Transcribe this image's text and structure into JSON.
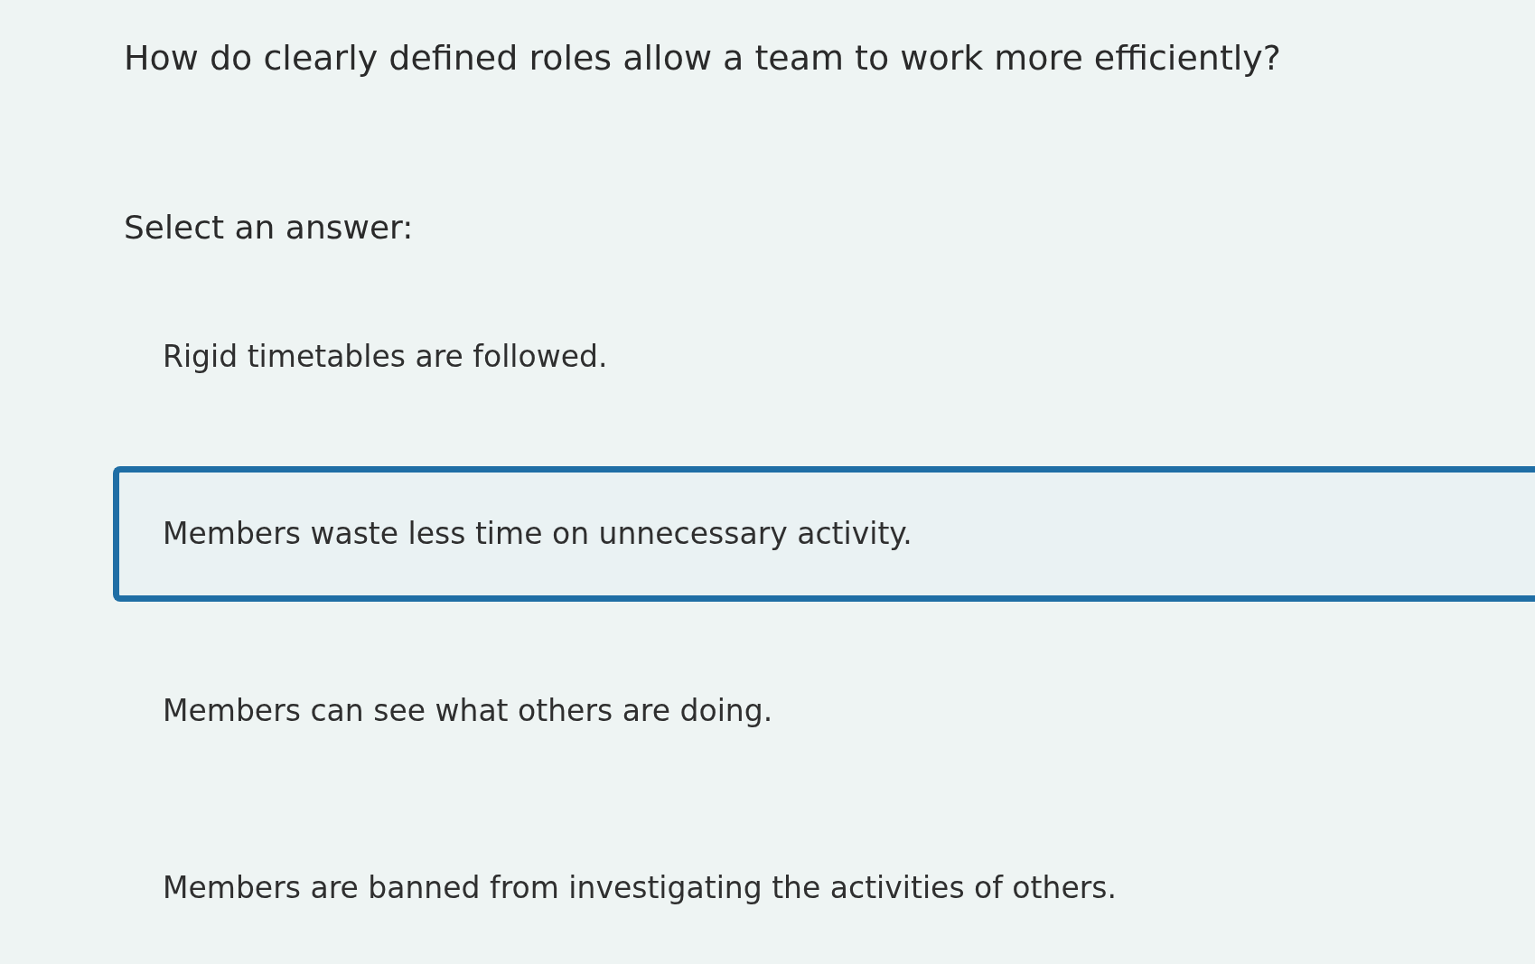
{
  "question": "How do clearly defined roles allow a team to work more efficiently?",
  "prompt": "Select an answer:",
  "options": [
    {
      "text": "Rigid timetables are followed.",
      "selected": false
    },
    {
      "text": "Members waste less time on unnecessary activity.",
      "selected": true
    },
    {
      "text": "Members can see what others are doing.",
      "selected": false
    },
    {
      "text": "Members are banned from investigating the activities of others.",
      "selected": false
    }
  ]
}
